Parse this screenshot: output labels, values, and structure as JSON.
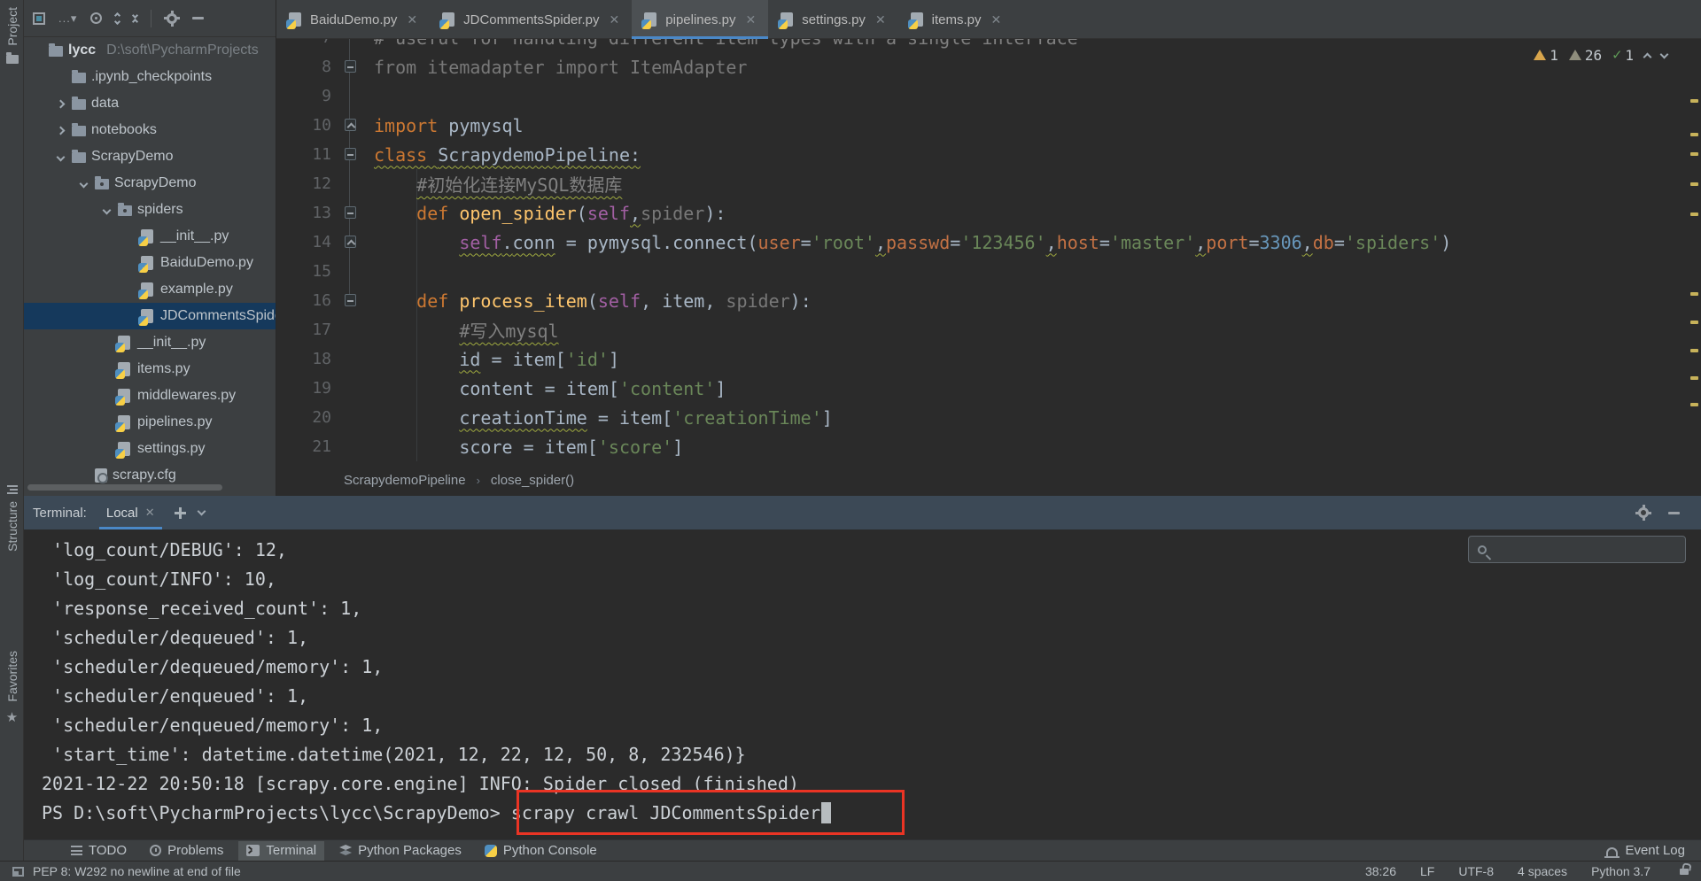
{
  "stripe": {
    "project": "Project",
    "structure": "Structure",
    "favorites": "Favorites"
  },
  "project": {
    "toolbar_icons": [
      "project-view-selector",
      "more-options",
      "locate-file",
      "expand-all",
      "collapse-all",
      "settings-gear",
      "hide-panel"
    ],
    "tree": [
      {
        "label": "lycc",
        "secondary": "D:\\soft\\PycharmProjects",
        "depth": 0,
        "icon": "folder",
        "chev": null,
        "bold": true,
        "selected": false
      },
      {
        "label": ".ipynb_checkpoints",
        "secondary": "",
        "depth": 1,
        "icon": "folder",
        "chev": null,
        "bold": false,
        "selected": false
      },
      {
        "label": "data",
        "secondary": "",
        "depth": 1,
        "icon": "folder",
        "chev": "right",
        "bold": false,
        "selected": false
      },
      {
        "label": "notebooks",
        "secondary": "",
        "depth": 1,
        "icon": "folder",
        "chev": "right",
        "bold": false,
        "selected": false
      },
      {
        "label": "ScrapyDemo",
        "secondary": "",
        "depth": 1,
        "icon": "folder",
        "chev": "down",
        "bold": false,
        "selected": false
      },
      {
        "label": "ScrapyDemo",
        "secondary": "",
        "depth": 2,
        "icon": "package",
        "chev": "down",
        "bold": false,
        "selected": false
      },
      {
        "label": "spiders",
        "secondary": "",
        "depth": 3,
        "icon": "package",
        "chev": "down",
        "bold": false,
        "selected": false
      },
      {
        "label": "__init__.py",
        "secondary": "",
        "depth": 4,
        "icon": "py",
        "chev": null,
        "bold": false,
        "selected": false
      },
      {
        "label": "BaiduDemo.py",
        "secondary": "",
        "depth": 4,
        "icon": "py",
        "chev": null,
        "bold": false,
        "selected": false
      },
      {
        "label": "example.py",
        "secondary": "",
        "depth": 4,
        "icon": "py",
        "chev": null,
        "bold": false,
        "selected": false
      },
      {
        "label": "JDCommentsSpider.py",
        "secondary": "",
        "depth": 4,
        "icon": "py",
        "chev": null,
        "bold": false,
        "selected": true
      },
      {
        "label": "__init__.py",
        "secondary": "",
        "depth": 3,
        "icon": "py",
        "chev": null,
        "bold": false,
        "selected": false
      },
      {
        "label": "items.py",
        "secondary": "",
        "depth": 3,
        "icon": "py",
        "chev": null,
        "bold": false,
        "selected": false
      },
      {
        "label": "middlewares.py",
        "secondary": "",
        "depth": 3,
        "icon": "py",
        "chev": null,
        "bold": false,
        "selected": false
      },
      {
        "label": "pipelines.py",
        "secondary": "",
        "depth": 3,
        "icon": "py",
        "chev": null,
        "bold": false,
        "selected": false
      },
      {
        "label": "settings.py",
        "secondary": "",
        "depth": 3,
        "icon": "py",
        "chev": null,
        "bold": false,
        "selected": false
      },
      {
        "label": "scrapy.cfg",
        "secondary": "",
        "depth": 2,
        "icon": "cfg",
        "chev": null,
        "bold": false,
        "selected": false
      }
    ]
  },
  "editor": {
    "tabs": [
      {
        "label": "BaiduDemo.py",
        "active": false
      },
      {
        "label": "JDCommentsSpider.py",
        "active": false
      },
      {
        "label": "pipelines.py",
        "active": true
      },
      {
        "label": "settings.py",
        "active": false
      },
      {
        "label": "items.py",
        "active": false
      }
    ],
    "inspections": {
      "warning": "1",
      "weak_warning": "26",
      "ok": "1"
    },
    "breadcrumb": {
      "class_name": "ScrapydemoPipeline",
      "sep": "›",
      "method": "close_spider()"
    },
    "lines": [
      {
        "n": 7,
        "fold": null,
        "seg": [
          [
            "# useful for handling different item types with a single interface",
            "cmt"
          ]
        ]
      },
      {
        "n": 8,
        "fold": "m",
        "seg": [
          [
            "from itemadapter import ItemAdapter",
            "gray"
          ]
        ]
      },
      {
        "n": 9,
        "fold": null,
        "seg": []
      },
      {
        "n": 10,
        "fold": "u",
        "seg": [
          [
            "import ",
            "kw"
          ],
          [
            "pymysql",
            "txt"
          ]
        ]
      },
      {
        "n": 11,
        "fold": "m",
        "seg": [
          [
            "class ",
            "kw w"
          ],
          [
            "ScrapydemoPipeline:",
            "txt w"
          ]
        ]
      },
      {
        "n": 12,
        "fold": null,
        "seg": [
          [
            "    ",
            "txt"
          ],
          [
            "#初始化连接MySQL数据库",
            "cmt w"
          ]
        ]
      },
      {
        "n": 13,
        "fold": "m",
        "seg": [
          [
            "    ",
            "txt"
          ],
          [
            "def ",
            "kw"
          ],
          [
            "open_spider",
            "fn"
          ],
          [
            "(",
            "txt"
          ],
          [
            "self",
            "self"
          ],
          [
            ",",
            "txt w"
          ],
          [
            "spider",
            "gray"
          ],
          [
            "):",
            "txt"
          ]
        ]
      },
      {
        "n": 14,
        "fold": "u",
        "seg": [
          [
            "        ",
            "txt"
          ],
          [
            "self",
            "self w"
          ],
          [
            ".",
            "txt w"
          ],
          [
            "conn",
            "txt w"
          ],
          [
            " = ",
            "txt"
          ],
          [
            "pymysql.connect(",
            "txt"
          ],
          [
            "user",
            "arg"
          ],
          [
            "=",
            "txt"
          ],
          [
            "'root'",
            "str"
          ],
          [
            ",",
            "txt w"
          ],
          [
            "passwd",
            "arg"
          ],
          [
            "=",
            "txt"
          ],
          [
            "'123456'",
            "str"
          ],
          [
            ",",
            "txt w"
          ],
          [
            "host",
            "arg"
          ],
          [
            "=",
            "txt"
          ],
          [
            "'master'",
            "str"
          ],
          [
            ",",
            "txt w"
          ],
          [
            "port",
            "arg"
          ],
          [
            "=",
            "txt"
          ],
          [
            "3306",
            "num"
          ],
          [
            ",",
            "txt w"
          ],
          [
            "db",
            "arg"
          ],
          [
            "=",
            "txt"
          ],
          [
            "'spiders'",
            "str"
          ],
          [
            ")",
            "txt"
          ]
        ]
      },
      {
        "n": 15,
        "fold": null,
        "seg": []
      },
      {
        "n": 16,
        "fold": "m",
        "seg": [
          [
            "    ",
            "txt"
          ],
          [
            "def ",
            "kw"
          ],
          [
            "process_item",
            "fn"
          ],
          [
            "(",
            "txt"
          ],
          [
            "self",
            "self"
          ],
          [
            ", ",
            "txt"
          ],
          [
            "item",
            "txt"
          ],
          [
            ", ",
            "txt"
          ],
          [
            "spider",
            "gray"
          ],
          [
            "):",
            "txt"
          ]
        ]
      },
      {
        "n": 17,
        "fold": null,
        "seg": [
          [
            "        ",
            "txt"
          ],
          [
            "#写入mysql",
            "cmt w"
          ]
        ]
      },
      {
        "n": 18,
        "fold": null,
        "seg": [
          [
            "        ",
            "txt"
          ],
          [
            "id",
            "txt w"
          ],
          [
            " = ",
            "txt"
          ],
          [
            "item",
            "txt"
          ],
          [
            "[",
            "txt"
          ],
          [
            "'id'",
            "str"
          ],
          [
            "]",
            "txt"
          ]
        ]
      },
      {
        "n": 19,
        "fold": null,
        "seg": [
          [
            "        ",
            "txt"
          ],
          [
            "content",
            "txt"
          ],
          [
            " = ",
            "txt"
          ],
          [
            "item",
            "txt"
          ],
          [
            "[",
            "txt"
          ],
          [
            "'content'",
            "str"
          ],
          [
            "]",
            "txt"
          ]
        ]
      },
      {
        "n": 20,
        "fold": null,
        "seg": [
          [
            "        ",
            "txt"
          ],
          [
            "creationTime",
            "txt w"
          ],
          [
            " = ",
            "txt"
          ],
          [
            "item",
            "txt"
          ],
          [
            "[",
            "txt"
          ],
          [
            "'creationTime'",
            "str"
          ],
          [
            "]",
            "txt"
          ]
        ]
      },
      {
        "n": 21,
        "fold": null,
        "seg": [
          [
            "        ",
            "txt"
          ],
          [
            "score",
            "txt"
          ],
          [
            " = ",
            "txt"
          ],
          [
            "item",
            "txt"
          ],
          [
            "[",
            "txt"
          ],
          [
            "'score'",
            "str"
          ],
          [
            "]",
            "txt"
          ]
        ]
      }
    ]
  },
  "terminal": {
    "label": "Terminal:",
    "tab": "Local",
    "lines": [
      " 'log_count/DEBUG': 12,",
      " 'log_count/INFO': 10,",
      " 'response_received_count': 1,",
      " 'scheduler/dequeued': 1,",
      " 'scheduler/dequeued/memory': 1,",
      " 'scheduler/enqueued': 1,",
      " 'scheduler/enqueued/memory': 1,",
      " 'start_time': datetime.datetime(2021, 12, 22, 12, 50, 8, 232546)}",
      "2021-12-22 20:50:18 [scrapy.core.engine] INFO: Spider closed (finished)"
    ],
    "prompt": "PS D:\\soft\\PycharmProjects\\lycc\\ScrapyDemo>",
    "command": " scrapy crawl JDCommentsSpider"
  },
  "bottom_bar": {
    "items": [
      {
        "label": "TODO",
        "icon": "todo-list-icon",
        "active": false
      },
      {
        "label": "Problems",
        "icon": "problems-icon",
        "active": false
      },
      {
        "label": "Terminal",
        "icon": "terminal-icon",
        "active": true
      },
      {
        "label": "Python Packages",
        "icon": "packages-icon",
        "active": false
      },
      {
        "label": "Python Console",
        "icon": "python-icon",
        "active": false
      }
    ],
    "right": {
      "label": "Event Log",
      "icon": "bell-icon"
    }
  },
  "status_bar": {
    "message": "PEP 8: W292 no newline at end of file",
    "items": [
      "38:26",
      "LF",
      "UTF-8",
      "4 spaces",
      "Python 3.7"
    ]
  },
  "colors": {
    "accent_blue": "#4a88c7",
    "annotation_red": "#ea3424",
    "selection_blue": "#15395c"
  }
}
